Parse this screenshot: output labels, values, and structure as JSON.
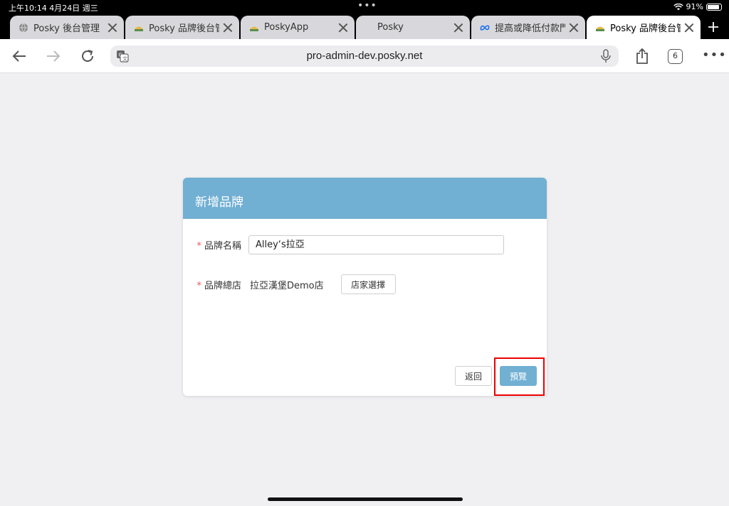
{
  "status": {
    "time": "上午10:14   4月24日 週三",
    "battery": "91%",
    "battery_level": 0.91
  },
  "tabs": [
    {
      "title": "Posky 後台管理",
      "icon": "globe-icon"
    },
    {
      "title": "Posky 品牌後台管理",
      "icon": "posky-favicon"
    },
    {
      "title": "PoskyApp",
      "icon": "posky-favicon"
    },
    {
      "title": "Posky",
      "icon": ""
    },
    {
      "title": "提高或降低付款門檻",
      "icon": "meta-icon"
    },
    {
      "title": "Posky 品牌後台管理",
      "icon": "posky-favicon",
      "active": true
    }
  ],
  "toolbar": {
    "url": "pro-admin-dev.posky.net",
    "tab_count": "6",
    "more": "•••"
  },
  "dialog": {
    "title": "新增品牌",
    "brand_name_label": "品牌名稱",
    "brand_name_value": "Alley‘s拉亞",
    "hq_store_label": "品牌總店",
    "hq_store_value": "拉亞漢堡Demo店",
    "store_select_label": "店家選擇",
    "required_mark": "*",
    "back_label": "返回",
    "preview_label": "預覽"
  },
  "colors": {
    "accent": "#71afd3",
    "highlight": "#ee0000"
  }
}
